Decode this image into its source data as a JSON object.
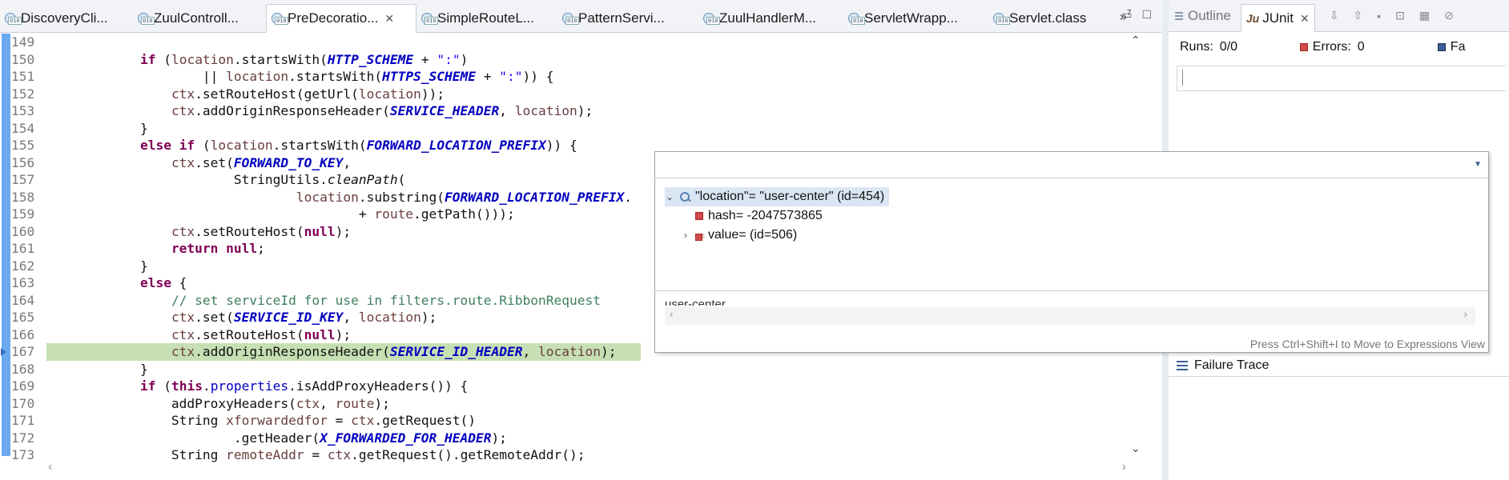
{
  "editor_tabs": [
    {
      "label": "DiscoveryCli..."
    },
    {
      "label": "ZuulControll..."
    },
    {
      "label": "PreDecoratio...",
      "active": true
    },
    {
      "label": "SimpleRouteL..."
    },
    {
      "label": "PatternServi..."
    },
    {
      "label": "ZuulHandlerM..."
    },
    {
      "label": "ServletWrapp..."
    },
    {
      "label": "Servlet.class"
    }
  ],
  "tab_overflow": "»",
  "tab_overflow_count": "7",
  "code_lines": {
    "l149": "149",
    "l150": "150",
    "l151": "151",
    "l152": "152",
    "l153": "153",
    "l154": "154",
    "l155": "155",
    "l156": "156",
    "l157": "157",
    "l158": "158",
    "l159": "159",
    "l160": "160",
    "l161": "161",
    "l162": "162",
    "l163": "163",
    "l164": "164",
    "l165": "165",
    "l166": "166",
    "l167": "167",
    "l168": "168",
    "l169": "169",
    "l170": "170",
    "l171": "171",
    "l172": "172",
    "l173": "173"
  },
  "code": {
    "comment_164": "// set serviceId for use in filters.route.RibbonRequest"
  },
  "inspect_popup": {
    "root_label": "\"location\"= \"user-center\" (id=454)",
    "hash_label": "hash= -2047573865",
    "value_label": "value= (id=506)",
    "detail_text": "user-center",
    "hint": "Press Ctrl+Shift+I to Move to Expressions View"
  },
  "side_panel": {
    "tab_outline": "Outline",
    "tab_junit": "JUnit",
    "runs_label": "Runs:",
    "runs_value": "0/0",
    "errors_label": "Errors:",
    "errors_value": "0",
    "failures_label": "Fa",
    "failure_trace": "Failure Trace"
  },
  "colors": {
    "current_line_highlight": "#c6dfb4",
    "keyword": "#7f0055",
    "constant": "#0000c0",
    "comment": "#3f7f5f",
    "gutter_marker": "#6aa8ef"
  },
  "icons": {
    "editor_tab": "class-file-icon",
    "popup_root": "inspect-magnifier-icon",
    "field": "private-field-icon"
  }
}
